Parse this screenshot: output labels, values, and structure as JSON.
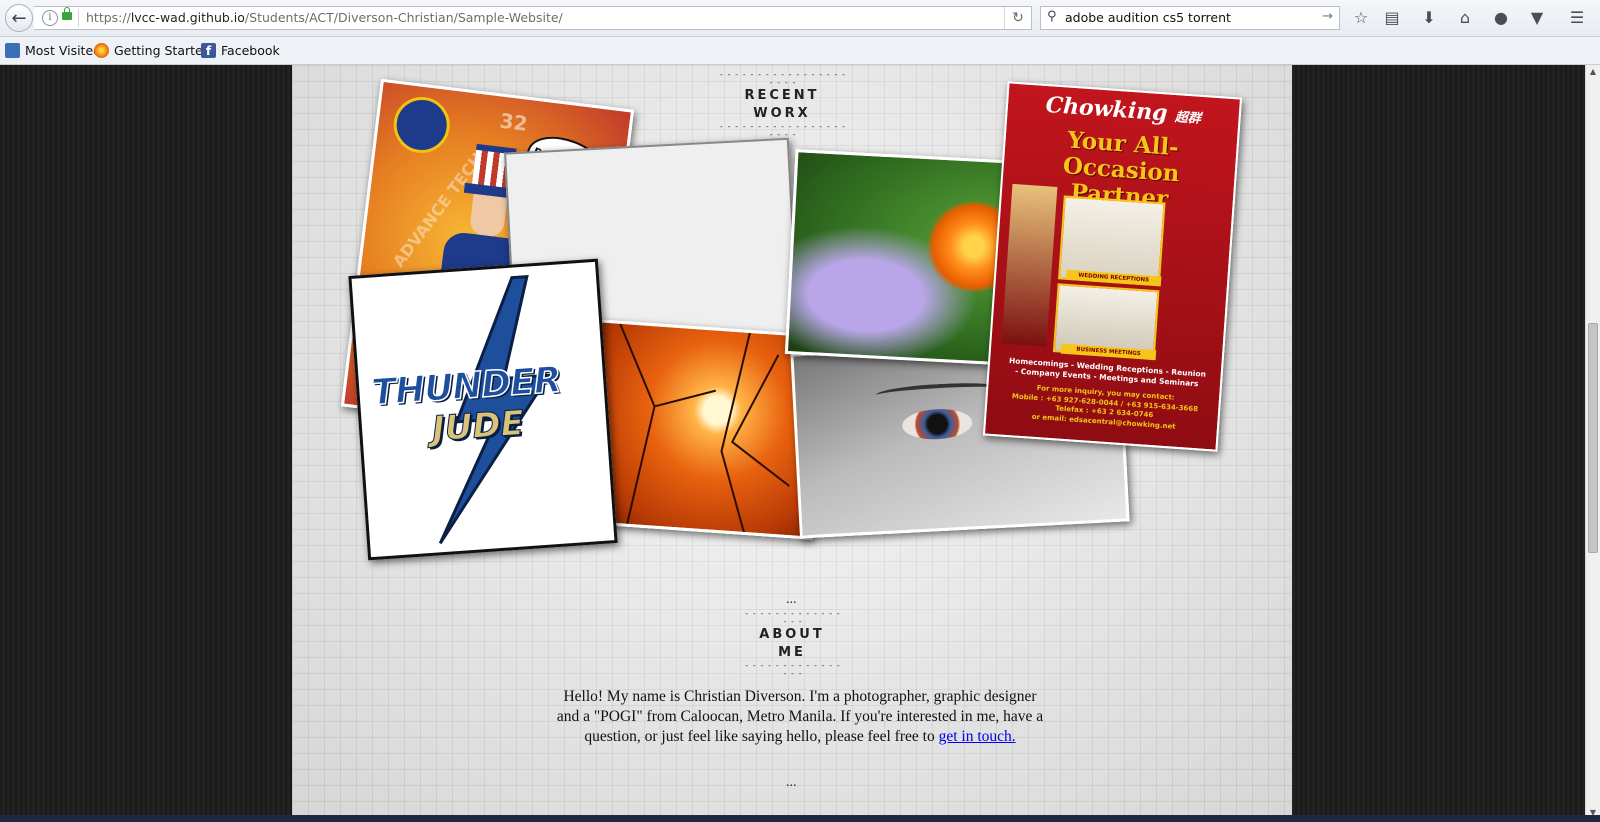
{
  "browser": {
    "url_prefix": "https://",
    "url_domain": "lvcc-wad.github.io",
    "url_path": "/Students/ACT/Diverson-Christian/Sample-Website/",
    "search_query": "adobe audition cs5 torrent",
    "bookmarks": [
      {
        "label": "Most Visited",
        "icon": "most-visited-icon"
      },
      {
        "label": "Getting Started",
        "icon": "firefox-icon"
      },
      {
        "label": "Facebook",
        "icon": "facebook-icon"
      }
    ]
  },
  "page": {
    "recent_title": "RECENT WORX",
    "about_title": "ABOUT ME",
    "about_text": "Hello! My name is Christian Diverson. I'm a photographer, graphic designer and a \"POGI\" from Caloocan, Metro Manila. If you're interested in me, have a question, or just feel like saying hello, please feel free to ",
    "about_link": "get in touch.",
    "ellipsis": "...",
    "gallery": {
      "poster_uncle_sam": {
        "speech": "BUY HERE!!",
        "number": "32",
        "ring_text": "ADVANCE TECH"
      },
      "thunder_jude": {
        "line1": "THUNDER",
        "line2": "JUDE"
      },
      "chowking": {
        "brand": "Chowking",
        "chinese": "超群",
        "headline": "Your All-Occasion Partner",
        "ribbon1": "WEDDING RECEPTIONS",
        "ribbon2": "BUSINESS MEETINGS",
        "events1": "Homecomings - Wedding Receptions - Reunion",
        "events2": "- Company Events - Meetings and Seminars",
        "inquiry": "For more inquiry, you may contact:",
        "mobile": "Mobile : +63 927-628-0044 / +63 915-634-3668",
        "telefax": "Telefax : +63 2 634-0746",
        "email": "or email: edsacentral@chowking.net"
      }
    }
  },
  "colors": {
    "link": "#0000ee",
    "chowking_red": "#b5121b",
    "chowking_yellow": "#f5c518",
    "thunder_blue": "#1d4f9c"
  }
}
